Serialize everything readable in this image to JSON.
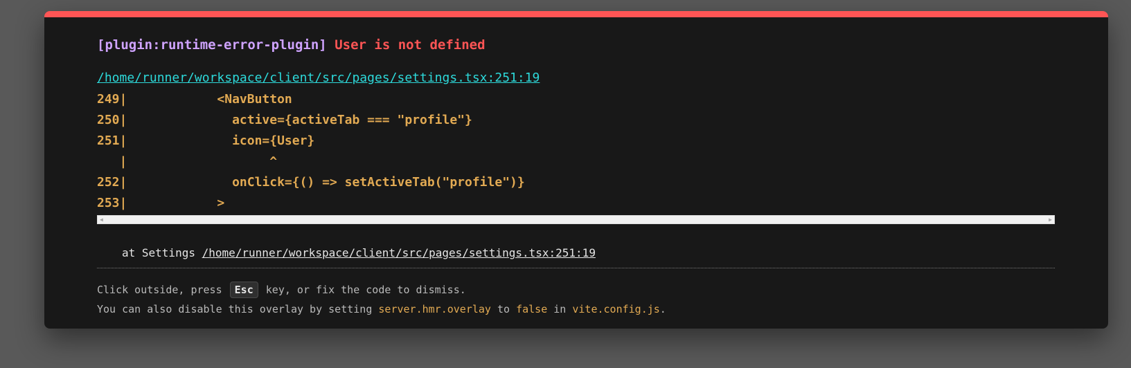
{
  "error": {
    "plugin": "[plugin:runtime-error-plugin]",
    "message": "User is not defined"
  },
  "file_link": "/home/runner/workspace/client/src/pages/settings.tsx:251:19",
  "frame_lines": [
    "249|            <NavButton",
    "250|              active={activeTab === \"profile\"}",
    "251|              icon={User}",
    "   |                   ^",
    "252|              onClick={() => setActiveTab(\"profile\")}",
    "253|            >"
  ],
  "stack": {
    "prefix": "at Settings",
    "link": "/home/runner/workspace/client/src/pages/settings.tsx:251:19"
  },
  "tips": {
    "line1_before": "Click outside, press",
    "line1_key": "Esc",
    "line1_after": "key, or fix the code to dismiss.",
    "line2_before": "You can also disable this overlay by setting",
    "line2_setting": "server.hmr.overlay",
    "line2_mid": "to",
    "line2_value": "false",
    "line2_in": "in",
    "line2_file": "vite.config.js",
    "line2_end": "."
  },
  "icons": {
    "scroll_left": "scroll-left-arrow-icon",
    "scroll_right": "scroll-right-arrow-icon"
  },
  "colors": {
    "accent_red": "#ff5555",
    "plugin_purple": "#cfa3ff",
    "link_cyan": "#2dd9da",
    "code_yellow": "#e2aa53"
  }
}
